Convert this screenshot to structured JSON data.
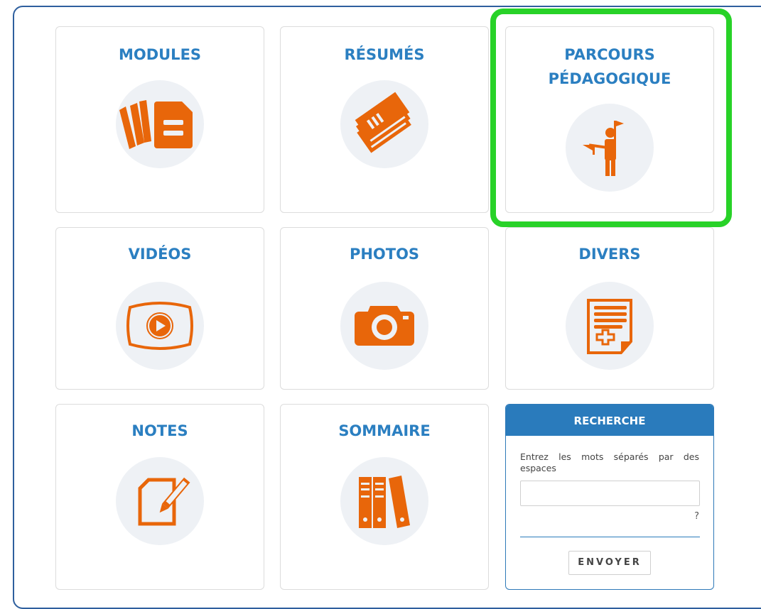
{
  "tiles": {
    "modules": {
      "title": "MODULES",
      "icon": "cards-document-icon"
    },
    "resumes": {
      "title": "RÉSUMÉS",
      "icon": "stacked-notes-icon"
    },
    "parcours": {
      "title_line1": "PARCOURS",
      "title_line2": "PÉDAGOGIQUE",
      "icon": "guide-with-flags-icon"
    },
    "videos": {
      "title": "VIDÉOS",
      "icon": "video-player-icon"
    },
    "photos": {
      "title": "PHOTOS",
      "icon": "camera-icon"
    },
    "divers": {
      "title": "DIVERS",
      "icon": "document-plus-icon"
    },
    "notes": {
      "title": "NOTES",
      "icon": "note-pencil-icon"
    },
    "sommaire": {
      "title": "SOMMAIRE",
      "icon": "binders-icon"
    }
  },
  "search": {
    "title": "RECHERCHE",
    "description": "Entrez les mots séparés par des espaces",
    "input_value": "",
    "help": "?",
    "submit_label": "ENVOYER"
  },
  "colors": {
    "accent_blue": "#2b7fc1",
    "icon_orange": "#e8660a",
    "highlight_green": "#28d228"
  }
}
